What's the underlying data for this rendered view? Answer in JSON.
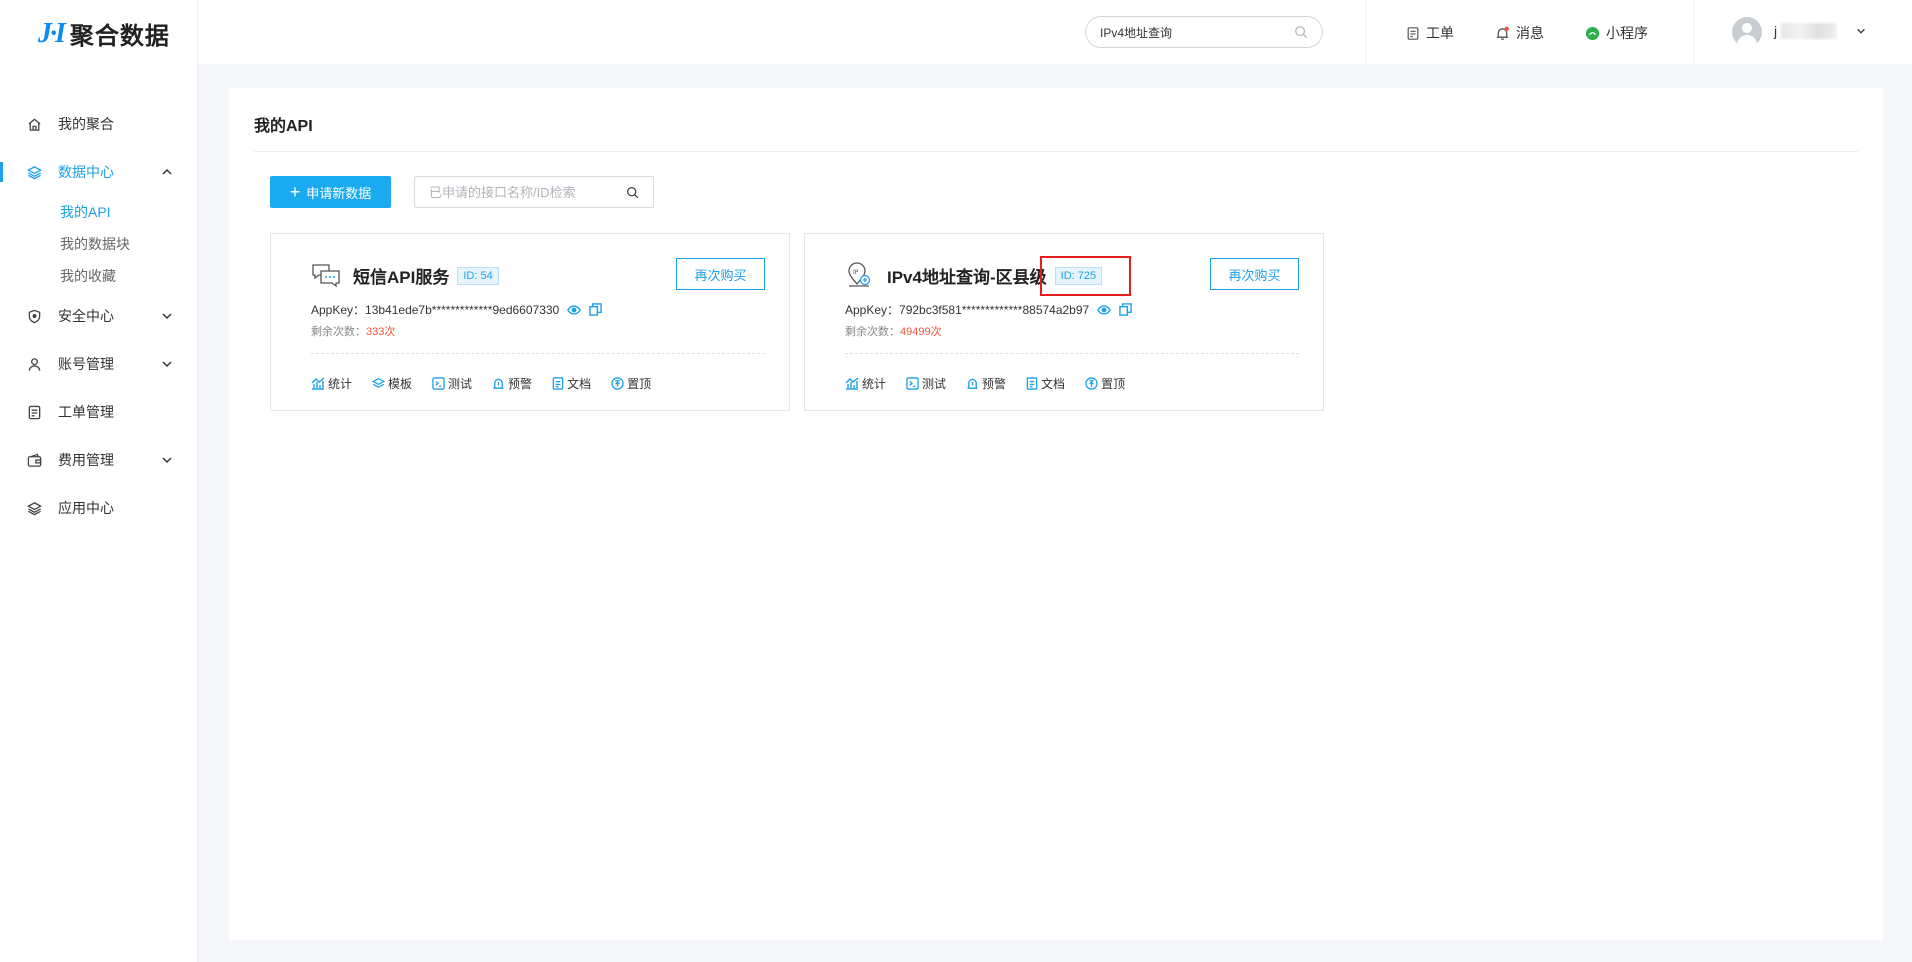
{
  "brand": {
    "mark": "J·I",
    "name": "聚合数据",
    "color": "#0b8cf0"
  },
  "sidebar": {
    "items": [
      {
        "label": "我的聚合",
        "icon": "home-icon"
      },
      {
        "label": "数据中心",
        "icon": "layers-icon",
        "expanded": true,
        "children": [
          {
            "label": "我的API",
            "active": true
          },
          {
            "label": "我的数据块"
          },
          {
            "label": "我的收藏"
          }
        ]
      },
      {
        "label": "安全中心",
        "icon": "shield-icon"
      },
      {
        "label": "账号管理",
        "icon": "user-icon"
      },
      {
        "label": "工单管理",
        "icon": "ticket-icon"
      },
      {
        "label": "费用管理",
        "icon": "wallet-icon"
      },
      {
        "label": "应用中心",
        "icon": "app-layers-icon"
      }
    ]
  },
  "header": {
    "search_value": "IPv4地址查询",
    "ticket_label": "工单",
    "message_label": "消息",
    "miniprogram_label": "小程序",
    "username_prefix": "j"
  },
  "main": {
    "title": "我的API",
    "new_button_label": "申请新数据",
    "search_placeholder": "已申请的接口名称/ID检索",
    "cards": [
      {
        "icon": "chat-bubbles-icon",
        "title": "短信API服务",
        "id_label": "ID: 54",
        "rebuy_label": "再次购买",
        "appkey_label": "AppKey：",
        "appkey": "13b41ede7b*************9ed6607330",
        "remain_label": "剩余次数：",
        "remain_value": "333次",
        "actions": [
          "统计",
          "模板",
          "测试",
          "预警",
          "文档",
          "置顶"
        ]
      },
      {
        "icon": "ip-location-icon",
        "title": "IPv4地址查询-区县级",
        "id_label": "ID: 725",
        "rebuy_label": "再次购买",
        "appkey_label": "AppKey：",
        "appkey": "792bc3f581*************88574a2b97",
        "remain_label": "剩余次数：",
        "remain_value": "49499次",
        "actions": [
          "统计",
          "测试",
          "预警",
          "文档",
          "置顶"
        ]
      }
    ]
  },
  "colors": {
    "accent": "#1ba0ea",
    "button": "#1ba9f0",
    "remain": "#f2553c",
    "highlight": "#e0201c"
  }
}
